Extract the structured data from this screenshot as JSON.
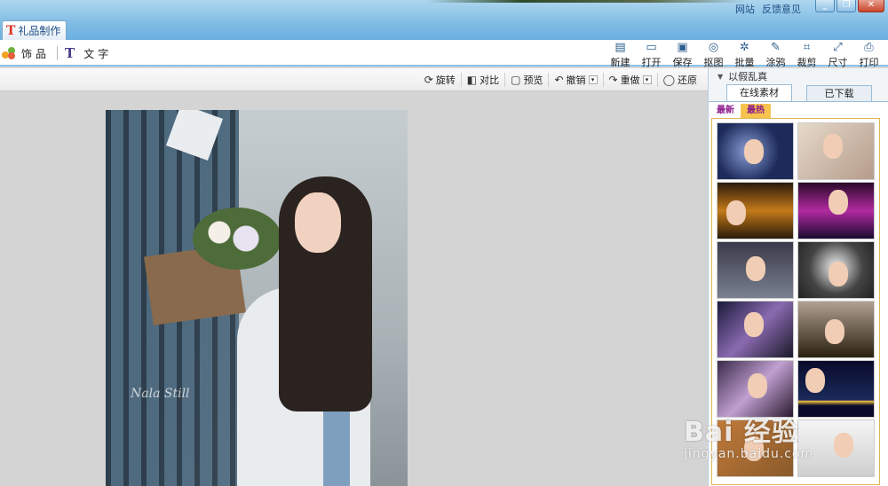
{
  "titlebar": {
    "links": [
      "网站",
      "反馈意见"
    ],
    "window_buttons": [
      "_",
      "❐",
      "✕"
    ]
  },
  "tab": {
    "label": "礼品制作",
    "icon": "T"
  },
  "toolbar": {
    "left": [
      {
        "label": "饰品",
        "icon": "ornament-icon"
      },
      {
        "label": "文字",
        "icon": "text-icon"
      }
    ],
    "right": [
      {
        "label": "新建",
        "icon": "new-file-icon",
        "glyph": "▤"
      },
      {
        "label": "打开",
        "icon": "folder-open-icon",
        "glyph": "▭"
      },
      {
        "label": "保存",
        "icon": "save-icon",
        "glyph": "▣"
      },
      {
        "label": "抠图",
        "icon": "cutout-icon",
        "glyph": "◎"
      },
      {
        "label": "批量",
        "icon": "batch-icon",
        "glyph": "✲"
      },
      {
        "label": "涂鸦",
        "icon": "doodle-icon",
        "glyph": "✎"
      },
      {
        "label": "裁剪",
        "icon": "crop-icon",
        "glyph": "⌗"
      },
      {
        "label": "尺寸",
        "icon": "resize-icon",
        "glyph": "⤢"
      },
      {
        "label": "打印",
        "icon": "print-icon",
        "glyph": "⎙"
      }
    ]
  },
  "subbar": {
    "rotate": {
      "label": "旋转",
      "glyph": "⟳"
    },
    "compare": {
      "label": "对比",
      "glyph": "◧"
    },
    "preview": {
      "label": "预览",
      "glyph": "▢"
    },
    "undo": {
      "label": "撤销",
      "glyph": "↶"
    },
    "redo": {
      "label": "重做",
      "glyph": "↷"
    },
    "restore": {
      "label": "还原",
      "glyph": "◯"
    },
    "dropdown_glyph": "▾"
  },
  "canvas": {
    "signature": "Nala Still"
  },
  "panel": {
    "header": "以假乱真",
    "tabs": [
      "在线素材",
      "已下载"
    ],
    "subtabs": [
      "最新",
      "最热"
    ],
    "thumbnails": [
      "thumb-1",
      "thumb-2",
      "thumb-3",
      "thumb-4",
      "thumb-5",
      "thumb-6",
      "thumb-7",
      "thumb-8",
      "thumb-9",
      "thumb-10",
      "thumb-11",
      "thumb-12"
    ]
  },
  "watermark": {
    "line1": "Bai 经验",
    "line2": "jingyan.baidu.com"
  },
  "colors": {
    "title_bar": "#7fbce4",
    "accent": "#8cc0e8",
    "hot_tab": "#f6c44e"
  }
}
